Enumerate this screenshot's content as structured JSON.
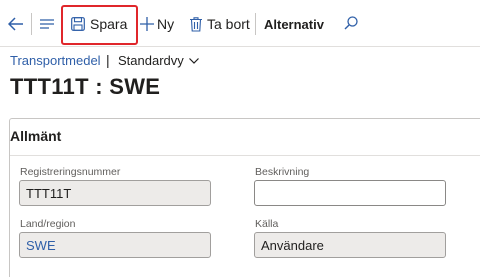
{
  "toolbar": {
    "save_label": "Spara",
    "new_label": "Ny",
    "delete_label": "Ta bort",
    "options_label": "Alternativ"
  },
  "breadcrumb": {
    "link": "Transportmedel",
    "separator": "|",
    "view": "Standardvy"
  },
  "page_title": "TTT11T : SWE",
  "section": {
    "title": "Allmänt",
    "fields": {
      "reg_label": "Registreringsnummer",
      "reg_value": "TTT11T",
      "desc_label": "Beskrivning",
      "desc_value": "",
      "country_label": "Land/region",
      "country_value": "SWE",
      "source_label": "Källa",
      "source_value": "Användare"
    }
  },
  "colors": {
    "accent_link": "#2f5fa8",
    "highlight_box": "#e0262b"
  },
  "icons": [
    "back-arrow-icon",
    "hamburger-icon",
    "save-icon",
    "plus-icon",
    "trash-icon",
    "search-icon",
    "chevron-down-icon"
  ]
}
